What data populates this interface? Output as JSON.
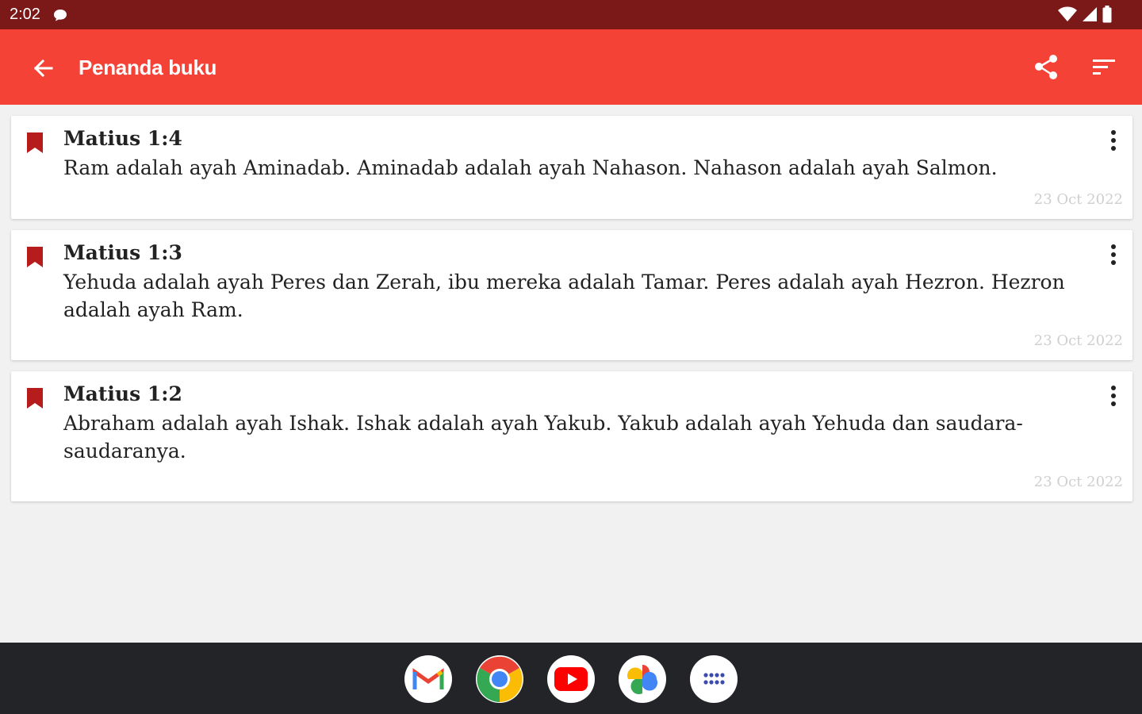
{
  "status_bar": {
    "time": "2:02"
  },
  "app_bar": {
    "title": "Penanda buku"
  },
  "colors": {
    "status_bar": "#7b1818",
    "app_bar": "#f44336",
    "bookmark": "#b71c1c",
    "nav_bar": "#232428"
  },
  "bookmarks": [
    {
      "reference": "Matius 1:4",
      "verse": "Ram adalah ayah Aminadab. Aminadab adalah ayah Nahason. Nahason adalah ayah Salmon.",
      "date": "23 Oct 2022"
    },
    {
      "reference": "Matius 1:3",
      "verse": "Yehuda adalah ayah Peres dan Zerah, ibu mereka adalah Tamar. Peres adalah ayah Hezron. Hezron adalah ayah Ram.",
      "date": "23 Oct 2022"
    },
    {
      "reference": "Matius 1:2",
      "verse": "Abraham adalah ayah Ishak. Ishak adalah ayah Yakub. Yakub adalah ayah Yehuda dan saudara-saudaranya.",
      "date": "23 Oct 2022"
    }
  ],
  "dock": [
    "gmail-icon",
    "chrome-icon",
    "youtube-icon",
    "photos-icon",
    "app-drawer-icon"
  ]
}
